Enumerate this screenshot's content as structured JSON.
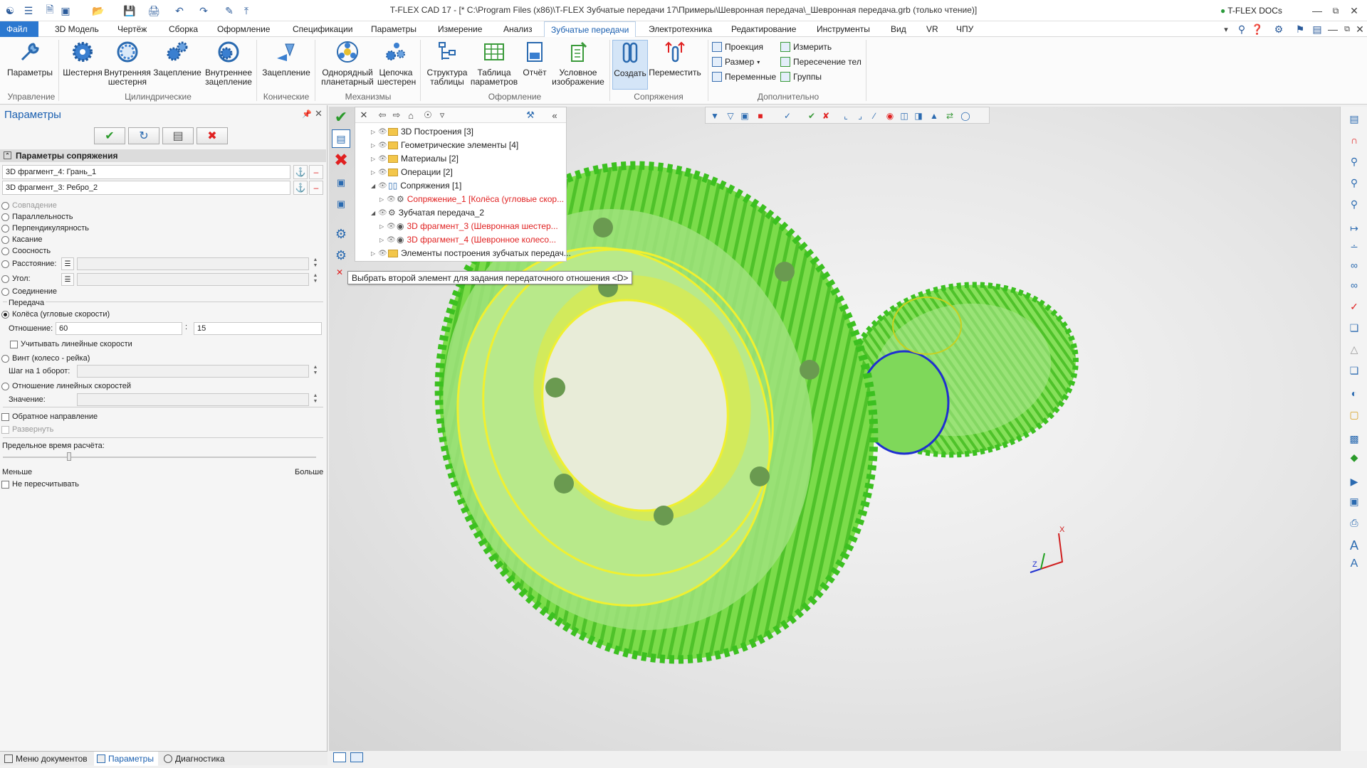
{
  "window": {
    "title": "T-FLEX CAD 17 - [* C:\\Program Files (x86)\\T-FLEX Зубчатые передачи 17\\Примеры\\Шевронная передача\\_Шевронная передача.grb (только чтение)]",
    "docs_label": "T-FLEX DOCs"
  },
  "menu": {
    "tabs": [
      "Файл",
      "3D Модель",
      "Чертёж",
      "Сборка",
      "Оформление",
      "Спецификации",
      "Параметры",
      "Измерение",
      "Анализ",
      "Зубчатые передачи",
      "Электротехника",
      "Редактирование",
      "Инструменты",
      "Вид",
      "VR",
      "ЧПУ"
    ],
    "active": "Зубчатые передачи"
  },
  "ribbon": {
    "buttons": [
      {
        "label": "Параметры"
      },
      {
        "label": "Шестерня"
      },
      {
        "label": "Внутренняя шестерня"
      },
      {
        "label": "Зацепление"
      },
      {
        "label": "Внутреннее зацепление"
      },
      {
        "label": "Зацепление"
      },
      {
        "label": "Однорядный планетарный"
      },
      {
        "label": "Цепочка шестерен"
      },
      {
        "label": "Структура таблицы"
      },
      {
        "label": "Таблица параметров"
      },
      {
        "label": "Отчёт"
      },
      {
        "label": "Условное изображение"
      },
      {
        "label": "Создать"
      },
      {
        "label": "Переместить"
      }
    ],
    "small": [
      "Проекция",
      "Размер",
      "Переменные",
      "Измерить",
      "Пересечение тел",
      "Группы"
    ],
    "groups": [
      "Управление",
      "Цилиндрические",
      "Конические",
      "Механизмы",
      "Оформление",
      "Сопряжения",
      "Дополнительно"
    ]
  },
  "params_panel": {
    "title": "Параметры",
    "section": "Параметры сопряжения",
    "fragment1": "3D фрагмент_4: Грань_1",
    "fragment2": "3D фрагмент_3: Ребро_2",
    "options": [
      "Совпадение",
      "Параллельность",
      "Перпендикулярность",
      "Касание",
      "Соосность",
      "Расстояние:",
      "Угол:",
      "Соединение"
    ],
    "transfer_label": "Передача",
    "wheels_label": "Колёса (угловые скорости)",
    "ratio_label": "Отношение:",
    "ratio_a": "60",
    "ratio_sep": ":",
    "ratio_b": "15",
    "linear_speeds": "Учитывать линейные скорости",
    "screw_label": "Винт (колесо - рейка)",
    "step_label": "Шаг на 1 оборот:",
    "linear_ratio_label": "Отношение линейных скоростей",
    "value_label": "Значение:",
    "reverse_label": "Обратное направление",
    "unfold_label": "Развернуть",
    "time_label": "Предельное время расчёта:",
    "less": "Меньше",
    "more": "Больше",
    "no_recalc": "Не пересчитывать"
  },
  "bottom_tabs": [
    "Меню документов",
    "Параметры",
    "Диагностика"
  ],
  "tree": {
    "nodes": [
      {
        "label": "3D Построения [3]"
      },
      {
        "label": "Геометрические элементы [4]"
      },
      {
        "label": "Материалы [2]"
      },
      {
        "label": "Операции [2]"
      },
      {
        "label": "Сопряжения [1]"
      },
      {
        "label": "Сопряжение_1 [Колёса (угловые скор..."
      },
      {
        "label": "Зубчатая передача_2"
      },
      {
        "label": "3D фрагмент_3 (Шевронная шестер..."
      },
      {
        "label": "3D фрагмент_4 (Шевронное колесо..."
      },
      {
        "label": "Элементы построения зубчатых передач..."
      }
    ]
  },
  "tooltip": "Выбрать второй элемент для задания передаточного отношения <D>",
  "axis": {
    "x": "X",
    "z": "Z"
  }
}
